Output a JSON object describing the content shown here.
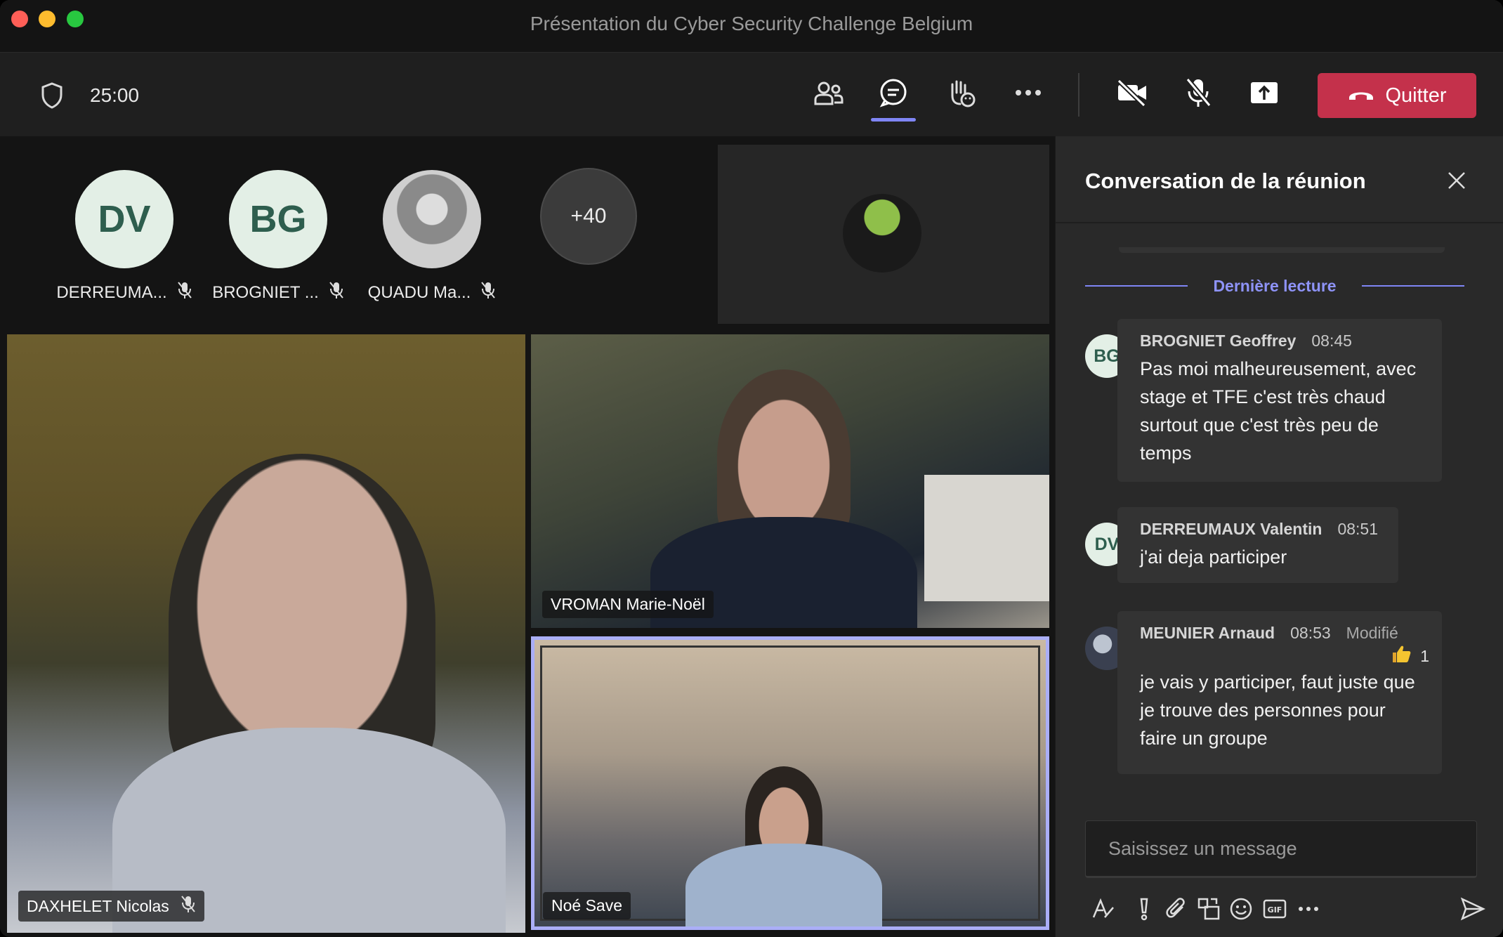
{
  "window": {
    "title": "Présentation du Cyber Security Challenge Belgium"
  },
  "toolbar": {
    "timer": "25:00",
    "quit_label": "Quitter"
  },
  "roster": {
    "participants": [
      {
        "initials": "DV",
        "name": "DERREUMA..."
      },
      {
        "initials": "BG",
        "name": "BROGNIET ..."
      },
      {
        "initials": "",
        "name": "QUADU Ma..."
      }
    ],
    "more_count": "+40"
  },
  "videos": [
    {
      "name": "DAXHELET Nicolas"
    },
    {
      "name": "VROMAN Marie-Noël"
    },
    {
      "name": "Noé Save"
    }
  ],
  "chat": {
    "title": "Conversation de la réunion",
    "last_read_label": "Dernière lecture",
    "messages": [
      {
        "initials": "BG",
        "author": "BROGNIET Geoffrey",
        "time": "08:45",
        "text": "Pas moi malheureusement, avec stage et TFE c'est très chaud surtout que c'est très peu de temps"
      },
      {
        "initials": "DV",
        "author": "DERREUMAUX Valentin",
        "time": "08:51",
        "text": "j'ai deja participer"
      },
      {
        "initials": "",
        "author": "MEUNIER Arnaud",
        "time": "08:53",
        "edited": "Modifié",
        "reaction_count": "1",
        "text": "je vais y participer, faut juste que je trouve des personnes pour faire un groupe"
      }
    ],
    "composer_placeholder": "Saisissez un message"
  },
  "colors": {
    "accent": "#7f85f5",
    "quit": "#c4314b",
    "status_busy": "#c4314b"
  }
}
